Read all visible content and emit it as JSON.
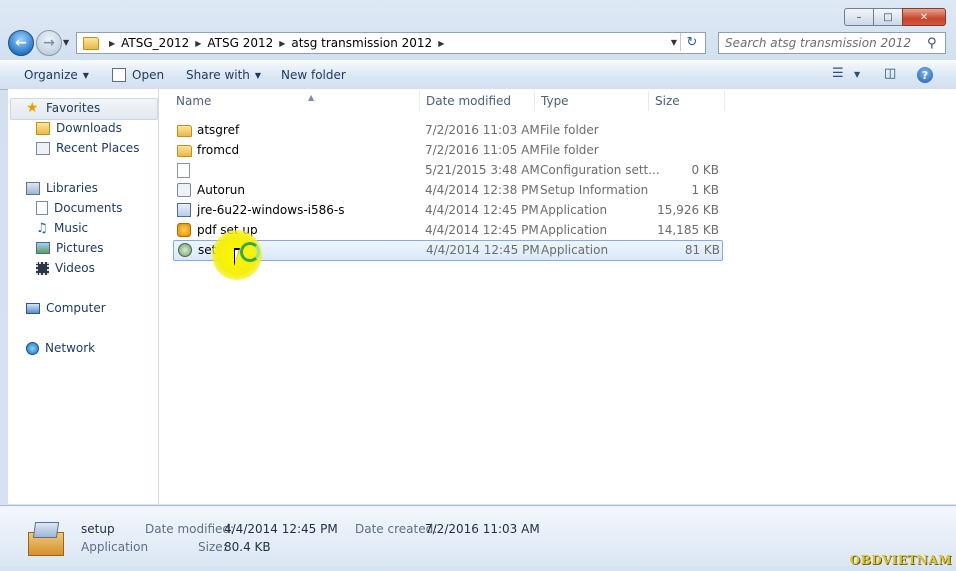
{
  "window": {
    "caption_buttons": [
      "minimize",
      "maximize",
      "close"
    ]
  },
  "nav": {
    "breadcrumbs": [
      "ATSG_2012",
      "ATSG 2012",
      "atsg transmission 2012"
    ],
    "search_placeholder": "Search atsg transmission 2012"
  },
  "toolbar": {
    "organize": "Organize",
    "open": "Open",
    "share_with": "Share with",
    "new_folder": "New folder"
  },
  "sidebar": {
    "favorites": "Favorites",
    "favorites_items": [
      "Downloads",
      "Recent Places"
    ],
    "libraries": "Libraries",
    "libraries_items": [
      "Documents",
      "Music",
      "Pictures",
      "Videos"
    ],
    "computer": "Computer",
    "network": "Network"
  },
  "columns": {
    "name": "Name",
    "date_modified": "Date modified",
    "type": "Type",
    "size": "Size"
  },
  "files": [
    {
      "name": "atsgref",
      "date": "7/2/2016 11:03 AM",
      "type": "File folder",
      "size": "",
      "icon": "folder-icon"
    },
    {
      "name": "fromcd",
      "date": "7/2/2016 11:05 AM",
      "type": "File folder",
      "size": "",
      "icon": "folder-icon"
    },
    {
      "name": "",
      "date": "5/21/2015 3:48 AM",
      "type": "Configuration sett...",
      "size": "0 KB",
      "icon": "config-file-icon"
    },
    {
      "name": "Autorun",
      "date": "4/4/2014 12:38 PM",
      "type": "Setup Information",
      "size": "1 KB",
      "icon": "setup-info-icon"
    },
    {
      "name": "jre-6u22-windows-i586-s",
      "date": "4/4/2014 12:45 PM",
      "type": "Application",
      "size": "15,926 KB",
      "icon": "java-icon"
    },
    {
      "name": "pdf set up",
      "date": "4/4/2014 12:45 PM",
      "type": "Application",
      "size": "14,185 KB",
      "icon": "pdf-setup-icon"
    },
    {
      "name": "setup",
      "date": "4/4/2014 12:45 PM",
      "type": "Application",
      "size": "81 KB",
      "icon": "setup-app-icon",
      "selected": true
    }
  ],
  "details": {
    "name": "setup",
    "kind": "Application",
    "date_modified_label": "Date modified:",
    "date_modified": "4/4/2014 12:45 PM",
    "size_label": "Size:",
    "size": "80.4 KB",
    "date_created_label": "Date created:",
    "date_created": "7/2/2016 11:03 AM"
  },
  "watermark": "OBDVIETNAM"
}
